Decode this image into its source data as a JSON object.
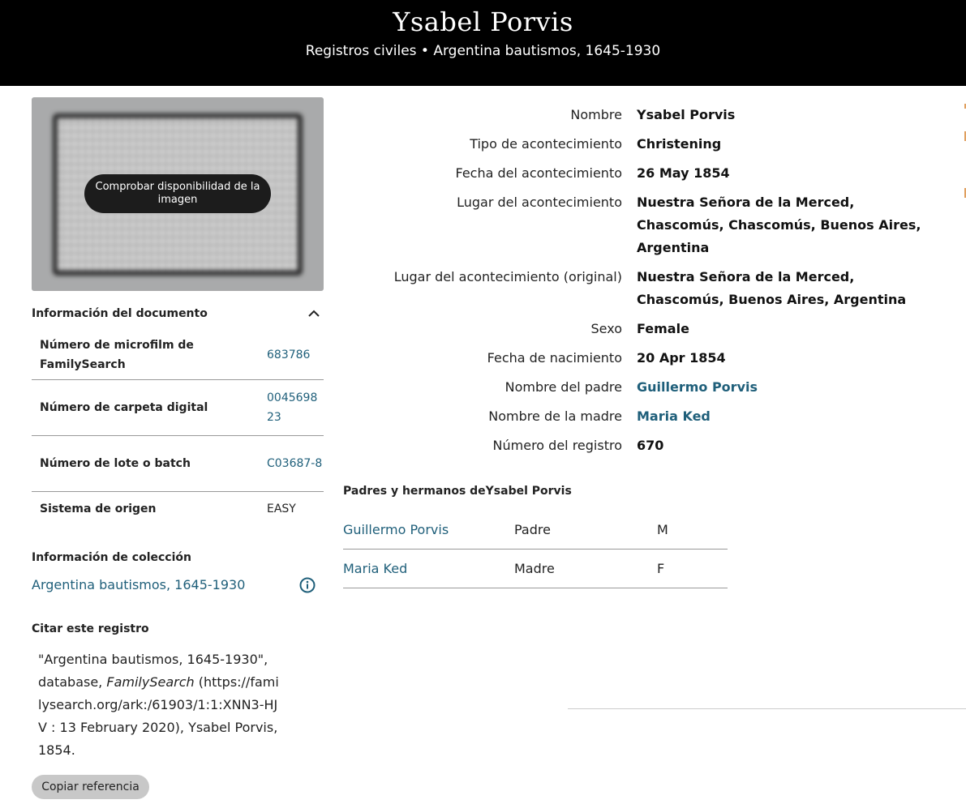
{
  "header": {
    "title": "Ysabel Porvis",
    "subtitle": "Registros civiles • Argentina bautismos, 1645-1930"
  },
  "image_preview": {
    "button_label": "Comprobar disponibilidad de la imagen"
  },
  "document_info": {
    "heading": "Información del documento",
    "rows": [
      {
        "label": "Número de microfilm de FamilySearch",
        "value": "683786"
      },
      {
        "label": "Número de carpeta digital",
        "value": "004569823"
      },
      {
        "label": "Número de lote o batch",
        "value": "C03687-8"
      },
      {
        "label": "Sistema de origen",
        "value": "EASY"
      }
    ]
  },
  "collection_info": {
    "heading": "Información de colección",
    "link": "Argentina bautismos, 1645-1930"
  },
  "citation": {
    "heading": "Citar este registro",
    "text_before": "\"Argentina bautismos, 1645-1930\", database, ",
    "text_italic": "FamilySearch",
    "text_after": " (https://familysearch.org/ark:/61903/1:1:XNN3-HJV : 13 February 2020), Ysabel Porvis, 1854.",
    "copy_button": "Copiar referencia"
  },
  "facts": [
    {
      "label": "Nombre",
      "value": "Ysabel Porvis"
    },
    {
      "label": "Tipo de acontecimiento",
      "value": "Christening"
    },
    {
      "label": "Fecha del acontecimiento",
      "value": "26 May 1854"
    },
    {
      "label": "Lugar del acontecimiento",
      "value": "Nuestra Señora de la Merced, Chascomús, Chascomús, Buenos Aires, Argentina"
    },
    {
      "label": "Lugar del acontecimiento (original)",
      "value": "Nuestra Señora de la Merced, Chascomús, Buenos Aires, Argentina"
    },
    {
      "label": "Sexo",
      "value": "Female"
    },
    {
      "label": "Fecha de nacimiento",
      "value": "20 Apr 1854"
    },
    {
      "label": "Nombre del padre",
      "value": "Guillermo Porvis"
    },
    {
      "label": "Nombre de la madre",
      "value": "Maria Ked"
    },
    {
      "label": "Número del registro",
      "value": "670"
    }
  ],
  "family": {
    "heading": "Padres y hermanos deYsabel Porvis",
    "members": [
      {
        "name": "Guillermo Porvis",
        "relation": "Padre",
        "sex": "M"
      },
      {
        "name": "Maria Ked",
        "relation": "Madre",
        "sex": "F"
      }
    ]
  },
  "colors": {
    "link": "#1f5f7a",
    "header_bg": "#000000"
  },
  "icons": [
    "chevron-up-icon",
    "info-icon"
  ]
}
